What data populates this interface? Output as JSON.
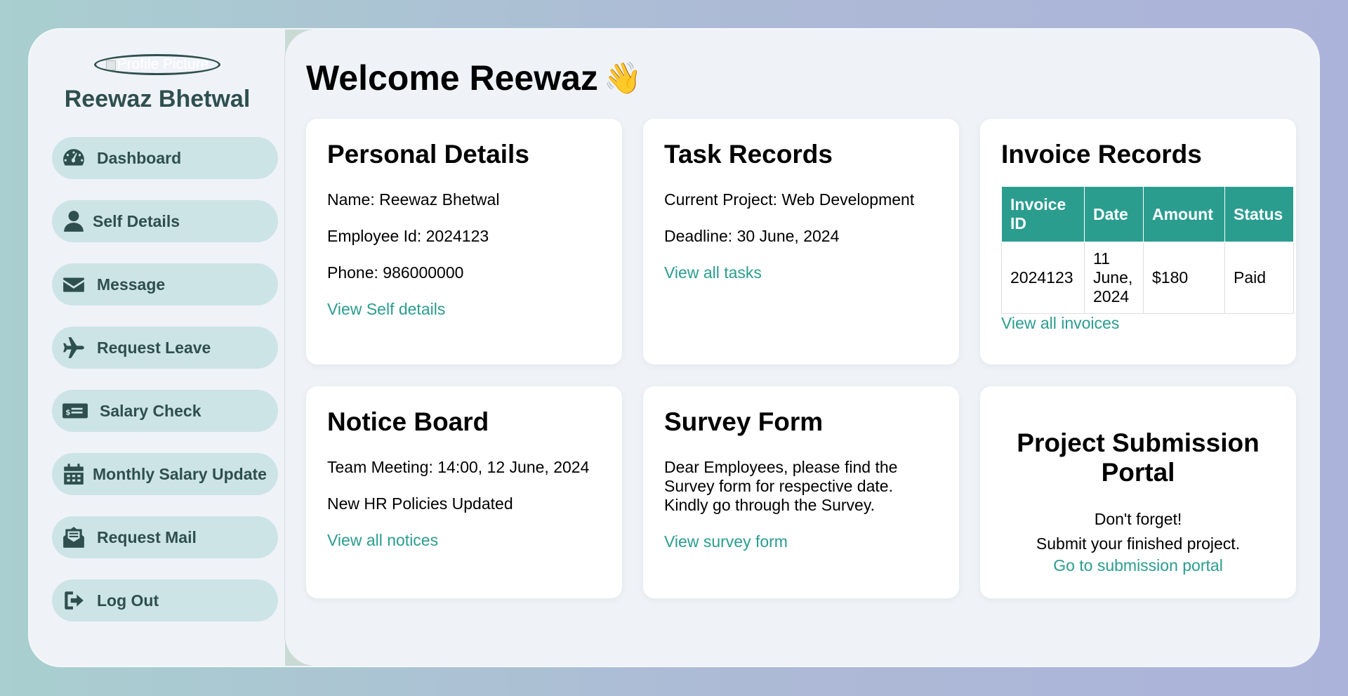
{
  "sidebar": {
    "profile_alt": "Profile Picture",
    "user_name": "Reewaz Bhetwal",
    "items": [
      {
        "label": "Dashboard",
        "icon": "gauge-icon"
      },
      {
        "label": "Self Details",
        "icon": "user-icon"
      },
      {
        "label": "Message",
        "icon": "envelope-icon"
      },
      {
        "label": "Request Leave",
        "icon": "plane-icon"
      },
      {
        "label": "Salary Check",
        "icon": "money-check-icon"
      },
      {
        "label": "Monthly Salary Update",
        "icon": "calendar-icon"
      },
      {
        "label": "Request Mail",
        "icon": "envelope-open-text-icon"
      },
      {
        "label": "Log Out",
        "icon": "sign-out-icon"
      }
    ]
  },
  "main": {
    "welcome": "Welcome Reewaz",
    "wave_emoji": "👋",
    "personal": {
      "title": "Personal Details",
      "name": "Name: Reewaz Bhetwal",
      "employee_id": "Employee Id: 2024123",
      "phone": "Phone: 986000000",
      "link": "View Self details"
    },
    "tasks": {
      "title": "Task Records",
      "project": "Current Project: Web Development",
      "deadline": "Deadline: 30 June, 2024",
      "link": "View all tasks"
    },
    "invoices": {
      "title": "Invoice Records",
      "headers": [
        "Invoice ID",
        "Date",
        "Amount",
        "Status"
      ],
      "row": [
        "2024123",
        "11 June, 2024",
        "$180",
        "Paid"
      ],
      "link": "View all invoices"
    },
    "notices": {
      "title": "Notice Board",
      "item1": "Team Meeting: 14:00, 12 June, 2024",
      "item2": "New HR Policies Updated",
      "link": "View all notices"
    },
    "survey": {
      "title": "Survey Form",
      "text": "Dear Employees, please find the Survey form for respective date. Kindly go through the Survey.",
      "link": "View survey form"
    },
    "submission": {
      "title": "Project Submission Portal",
      "line1": "Don't forget!",
      "line2": "Submit your finished project.",
      "link": "Go to submission portal"
    }
  },
  "colors": {
    "accent": "#2a9d8f",
    "nav_bg": "#cde4e7",
    "text_dark": "#2f4f4f"
  }
}
